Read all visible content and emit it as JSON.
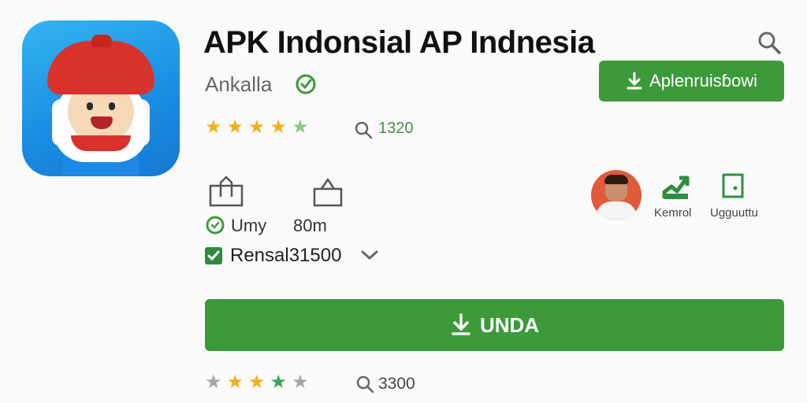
{
  "app": {
    "title": "APK Indonsial AP Indnesia",
    "developer": "Ankalla",
    "install_small_label": "Aplenruisɓowi",
    "install_main_label": "UNDA"
  },
  "rating": {
    "stars": [
      "#f2b01e",
      "#f2b01e",
      "#f2b01e",
      "#f2b01e",
      "#8fc987"
    ],
    "count": "1320"
  },
  "options": {
    "item1_label": "Umy",
    "item1_size": "80m",
    "checkbox_label": "Rensal31500"
  },
  "actions": {
    "trend_label": "Kemrol",
    "doc_label": "Ugguuttu"
  },
  "bottom_rating": {
    "stars": [
      "#a6a6a6",
      "#f2b01e",
      "#f2b01e",
      "#3ea35a",
      "#a6a6a6"
    ],
    "count": "3300"
  },
  "colors": {
    "accent_green": "#3d9a3b",
    "star_gold": "#f2b01e"
  }
}
